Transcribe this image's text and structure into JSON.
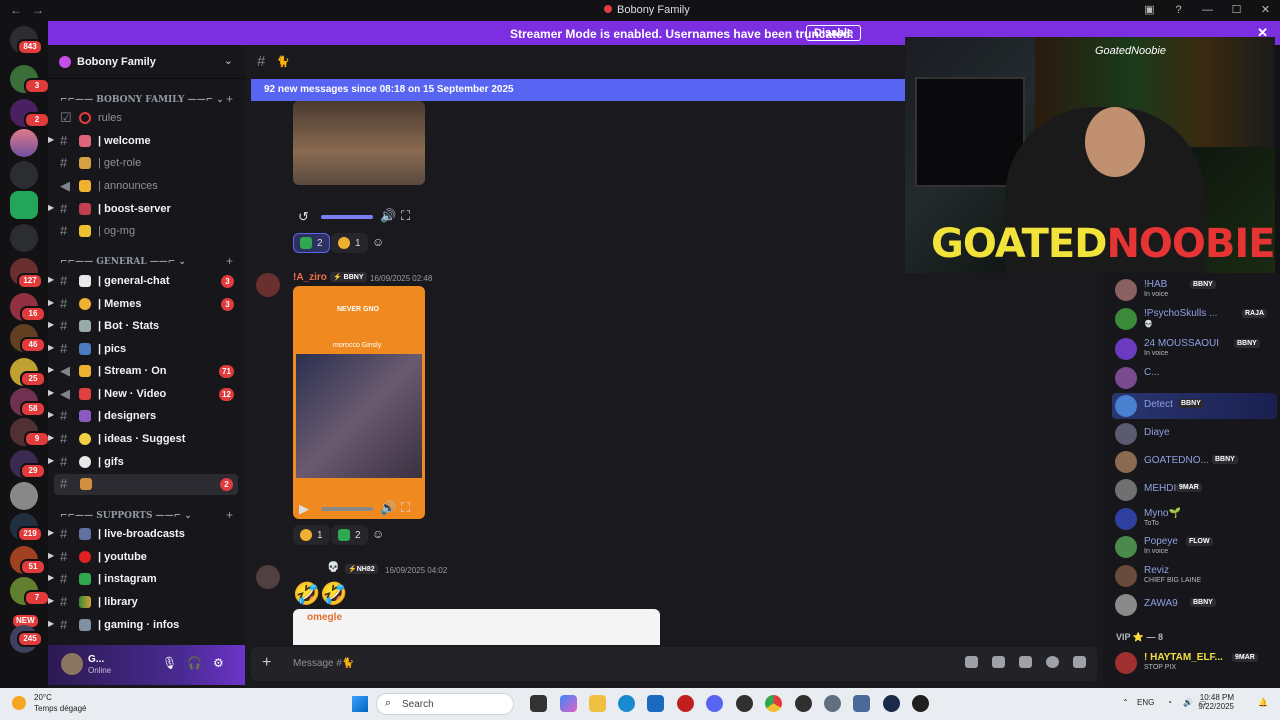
{
  "app": {
    "title": "Bobony Family"
  },
  "banner": {
    "message": "Streamer Mode is enabled. Usernames have been truncated.",
    "disable_label": "Disable"
  },
  "guild_badges": [
    "843",
    "3",
    "2",
    "127",
    "16",
    "46",
    "25",
    "58",
    "9",
    "29",
    "219",
    "51",
    "7",
    "NEW",
    "245"
  ],
  "server": {
    "name": "Bobony Family"
  },
  "categories": {
    "bobony": "BOBONY FAMILY",
    "general": "GENERAL",
    "supports": "SUPPORTS"
  },
  "channels": [
    {
      "name": "rules",
      "badge": ""
    },
    {
      "name": "| welcome",
      "badge": ""
    },
    {
      "name": "| get-role",
      "badge": ""
    },
    {
      "name": "| announces",
      "badge": ""
    },
    {
      "name": "| boost-server",
      "badge": ""
    },
    {
      "name": "| og-mg",
      "badge": ""
    },
    {
      "name": "| general-chat",
      "badge": "3"
    },
    {
      "name": "| Memes",
      "badge": "3"
    },
    {
      "name": "| Bot · Stats",
      "badge": ""
    },
    {
      "name": "| pics",
      "badge": ""
    },
    {
      "name": "| Stream · On",
      "badge": "71"
    },
    {
      "name": "| New · Video",
      "badge": "12"
    },
    {
      "name": "| designers",
      "badge": ""
    },
    {
      "name": "| ideas · Suggest",
      "badge": ""
    },
    {
      "name": "| gifs",
      "badge": ""
    },
    {
      "name": "🐈",
      "badge": "2"
    },
    {
      "name": "| live-broadcasts",
      "badge": ""
    },
    {
      "name": "| youtube",
      "badge": ""
    },
    {
      "name": "| instagram",
      "badge": ""
    },
    {
      "name": "| library",
      "badge": ""
    },
    {
      "name": "| gaming · infos",
      "badge": ""
    }
  ],
  "user": {
    "name": "G...",
    "status": "Online"
  },
  "chat": {
    "channel_name": "🐈",
    "new_messages": "92 new messages since 08:18 on 15 September 2025",
    "messages": [
      {
        "author": "",
        "tag": "",
        "time": "",
        "reactions": [
          {
            "count": "2"
          },
          {
            "count": "1"
          }
        ]
      },
      {
        "author": "!A_ziro",
        "tag": "BBNY",
        "time": "16/09/2025 02:48",
        "media_caption": "NEVER GNO",
        "media_sub": "morocco Ginsly",
        "reactions": [
          {
            "count": "1"
          },
          {
            "count": "2"
          }
        ]
      },
      {
        "author": "",
        "tag": "NH82",
        "time": "16/09/2025 04:02",
        "media_caption": "omegle",
        "reactions": []
      }
    ],
    "composer_placeholder": "Message #🐈"
  },
  "webcam": {
    "handle": "GoatedNoobie",
    "logo_a": "GOATED",
    "logo_b": "NOOBIE"
  },
  "members": [
    {
      "name": "!HAB",
      "sub": "In voice",
      "tag": "BBNY"
    },
    {
      "name": "!PsychoSkulls ...",
      "sub": "💀",
      "tag": "RAJA"
    },
    {
      "name": "24 MOUSSAOUI",
      "sub": "In voice",
      "tag": "BBNY"
    },
    {
      "name": "C...",
      "sub": "",
      "tag": ""
    },
    {
      "name": "Detect",
      "sub": "",
      "tag": "BBNY"
    },
    {
      "name": "Diaye",
      "sub": "",
      "tag": ""
    },
    {
      "name": "GOATEDNO...",
      "sub": "",
      "tag": "BBNY"
    },
    {
      "name": "MEHDI",
      "sub": "",
      "tag": "9MAR"
    },
    {
      "name": "Myno🌱",
      "sub": "ToTo",
      "tag": ""
    },
    {
      "name": "Popeye",
      "sub": "In voice",
      "tag": "FLOW"
    },
    {
      "name": "Reviz",
      "sub": "CHIEF BIG LAINE",
      "tag": ""
    },
    {
      "name": "ZAWA9",
      "sub": "",
      "tag": "BBNY"
    }
  ],
  "vip_label": "VIP ⭐ — 8",
  "vip_member": {
    "name": "! HAYTAM_ELF...",
    "sub": "STOP PIX",
    "tag": "9MAR"
  },
  "taskbar": {
    "temp": "20°C",
    "weather": "Temps dégagé",
    "search": "Search",
    "lang": "ENG",
    "time": "10:48 PM",
    "date": "9/22/2025"
  }
}
